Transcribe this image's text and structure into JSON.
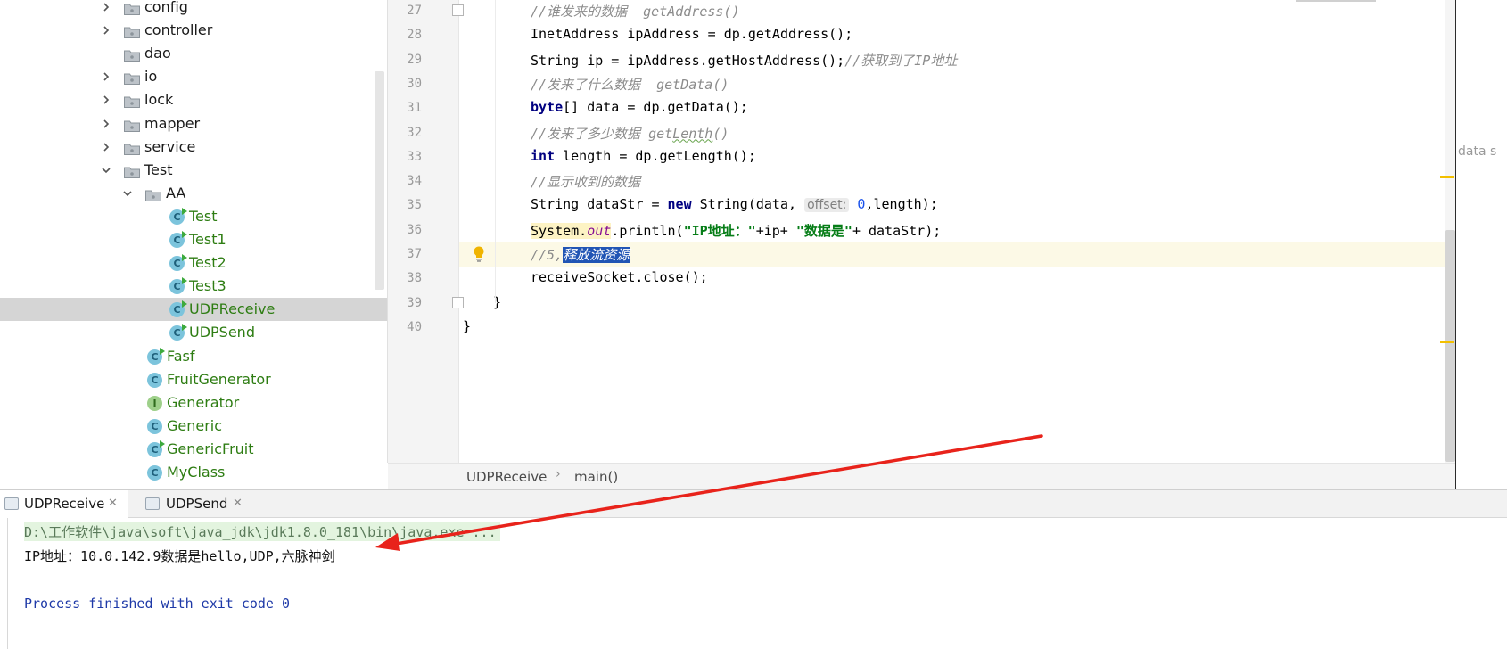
{
  "project_tree": {
    "nodes": [
      {
        "label": "config",
        "type": "folder",
        "expandable": true,
        "expanded": false,
        "depth": 0
      },
      {
        "label": "controller",
        "type": "folder",
        "expandable": true,
        "expanded": false,
        "depth": 0
      },
      {
        "label": "dao",
        "type": "folder",
        "expandable": false,
        "expanded": false,
        "depth": 0
      },
      {
        "label": "io",
        "type": "folder",
        "expandable": true,
        "expanded": false,
        "depth": 0
      },
      {
        "label": "lock",
        "type": "folder",
        "expandable": true,
        "expanded": false,
        "depth": 0
      },
      {
        "label": "mapper",
        "type": "folder",
        "expandable": true,
        "expanded": false,
        "depth": 0
      },
      {
        "label": "service",
        "type": "folder",
        "expandable": true,
        "expanded": false,
        "depth": 0
      },
      {
        "label": "Test",
        "type": "folder",
        "expandable": true,
        "expanded": true,
        "depth": 0
      },
      {
        "label": "AA",
        "type": "folder",
        "expandable": true,
        "expanded": true,
        "depth": 1
      },
      {
        "label": "Test",
        "type": "class-runnable",
        "depth": 2
      },
      {
        "label": "Test1",
        "type": "class-runnable",
        "depth": 2
      },
      {
        "label": "Test2",
        "type": "class-runnable",
        "depth": 2
      },
      {
        "label": "Test3",
        "type": "class-runnable",
        "depth": 2
      },
      {
        "label": "UDPReceive",
        "type": "class-runnable",
        "depth": 2,
        "selected": true
      },
      {
        "label": "UDPSend",
        "type": "class-runnable",
        "depth": 2
      },
      {
        "label": "Fasf",
        "type": "class-runnable",
        "depth": 1
      },
      {
        "label": "FruitGenerator",
        "type": "class",
        "depth": 1
      },
      {
        "label": "Generator",
        "type": "interface",
        "depth": 1
      },
      {
        "label": "Generic",
        "type": "class",
        "depth": 1
      },
      {
        "label": "GenericFruit",
        "type": "class-runnable",
        "depth": 1
      },
      {
        "label": "MyClass",
        "type": "class",
        "depth": 1
      }
    ]
  },
  "editor": {
    "line_numbers": [
      "27",
      "28",
      "29",
      "30",
      "31",
      "32",
      "33",
      "34",
      "35",
      "36",
      "37",
      "38",
      "39",
      "40"
    ],
    "lines": [
      [
        {
          "t": "//谁发来的数据  getAddress()",
          "c": "cm"
        }
      ],
      [
        {
          "t": "InetAddress ipAddress = dp.getAddress();",
          "c": ""
        }
      ],
      [
        {
          "t": "String ip = ipAddress.getHostAddress();",
          "c": ""
        },
        {
          "t": "//获取到了IP地址",
          "c": "cm"
        }
      ],
      [
        {
          "t": "//发来了什么数据  getData()",
          "c": "cm"
        }
      ],
      [
        {
          "t": "byte",
          "c": "kw"
        },
        {
          "t": "[] data = dp.getData();",
          "c": ""
        }
      ],
      [
        {
          "t": "//发来了多少数据 get",
          "c": "cm"
        },
        {
          "t": "Lenth",
          "c": "cm squig"
        },
        {
          "t": "()",
          "c": "cm"
        }
      ],
      [
        {
          "t": "int",
          "c": "kw"
        },
        {
          "t": " length = dp.getLength();",
          "c": ""
        }
      ],
      [
        {
          "t": "//显示收到的数据",
          "c": "cm"
        }
      ],
      [
        {
          "t": "String dataStr = ",
          "c": ""
        },
        {
          "t": "new",
          "c": "kw"
        },
        {
          "t": " String(data, ",
          "c": ""
        },
        {
          "t": "offset:",
          "c": "hint"
        },
        {
          "t": " ",
          "c": ""
        },
        {
          "t": "0",
          "c": "num"
        },
        {
          "t": ",length);",
          "c": ""
        }
      ],
      [
        {
          "t": "System.",
          "c": "sysbg"
        },
        {
          "t": "out",
          "c": "fld sysbg"
        },
        {
          "t": ".println(",
          "c": ""
        },
        {
          "t": "\"IP地址：\"",
          "c": "str"
        },
        {
          "t": "+ip+ ",
          "c": ""
        },
        {
          "t": "\"数据是\"",
          "c": "str"
        },
        {
          "t": "+ dataStr);",
          "c": ""
        }
      ],
      [
        {
          "t": "//5,",
          "c": "cm"
        },
        {
          "t": "释放流资源",
          "c": "cm sel"
        }
      ],
      [
        {
          "t": "receiveSocket.close();",
          "c": ""
        }
      ],
      [
        {
          "t": "}",
          "c": ""
        }
      ],
      [
        {
          "t": "}",
          "c": ""
        }
      ]
    ],
    "indents": [
      2,
      2,
      2,
      2,
      2,
      2,
      2,
      2,
      2,
      2,
      2,
      2,
      1,
      0
    ],
    "current_line_index": 10,
    "breadcrumb": [
      "UDPReceive",
      "main()"
    ],
    "right_panel_text": "a data s"
  },
  "run_tabs": [
    {
      "label": "UDPReceive",
      "active": true
    },
    {
      "label": "UDPSend",
      "active": false
    }
  ],
  "console": {
    "command": "D:\\工作软件\\java\\soft\\java_jdk\\jdk1.8.0_181\\bin\\java.exe ...",
    "output": "IP地址：10.0.142.9数据是hello,UDP,六脉神剑",
    "exit_message": "Process finished with exit code 0"
  },
  "colors": {
    "arrow": "#e8231b",
    "selection": "#2155b5",
    "keyword": "#000080",
    "string": "#067d17",
    "comment": "#8c8c8c",
    "class_label": "#2e7d13"
  }
}
